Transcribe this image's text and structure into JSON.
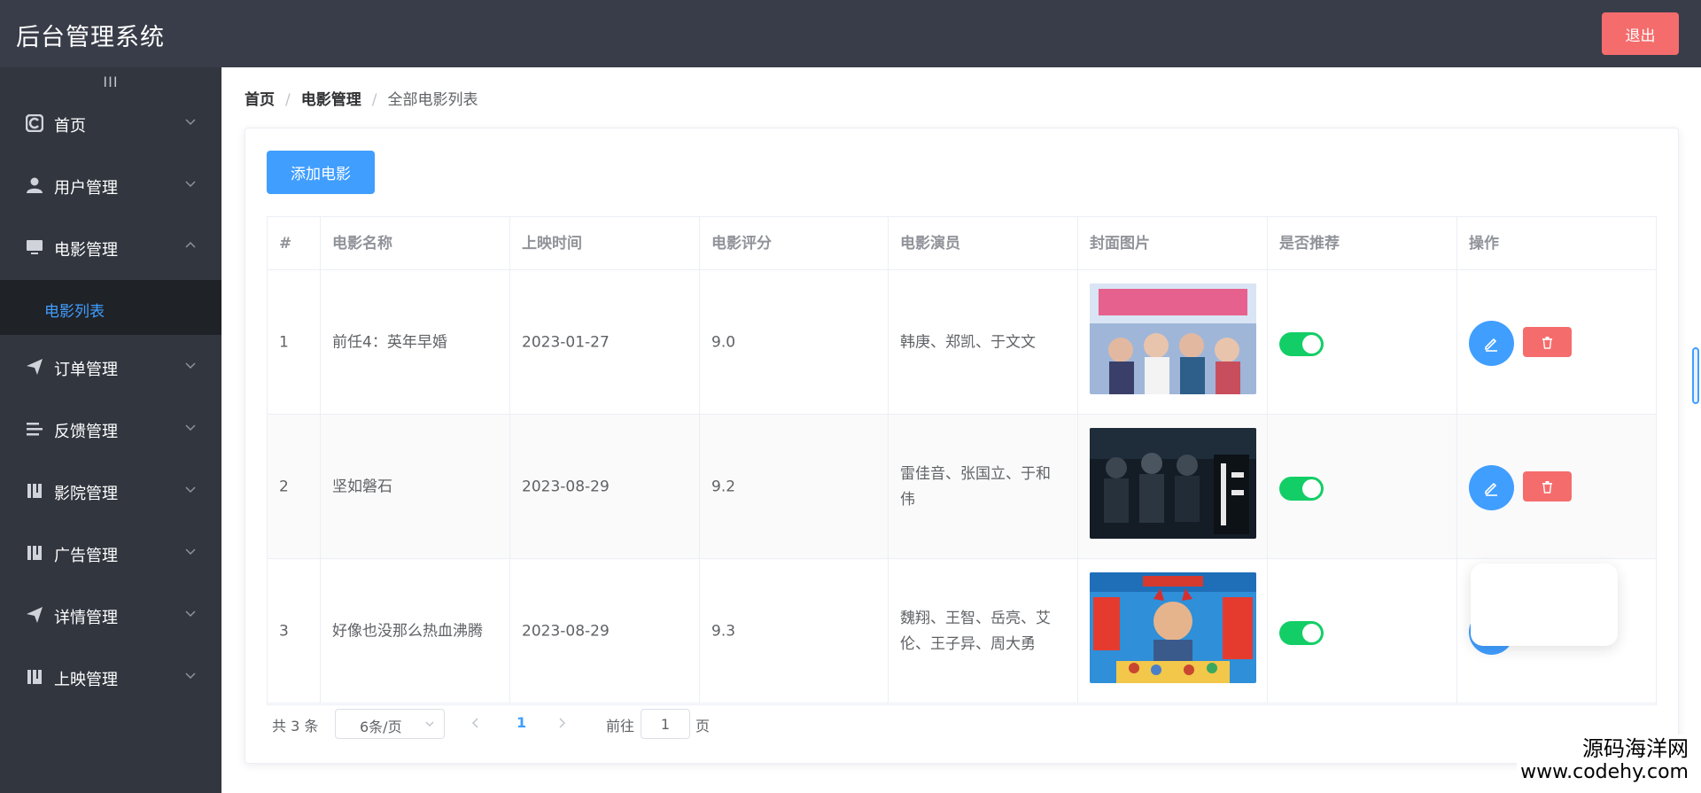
{
  "header": {
    "app_title": "后台管理系统",
    "logout_label": "退出"
  },
  "sidebar": {
    "toggle_glyph": "III",
    "items": [
      {
        "label": "首页",
        "icon": "dashboard-icon",
        "expanded": false
      },
      {
        "label": "用户管理",
        "icon": "user-icon",
        "expanded": false
      },
      {
        "label": "电影管理",
        "icon": "monitor-icon",
        "expanded": true
      },
      {
        "label": "订单管理",
        "icon": "paper-plane-icon",
        "expanded": false
      },
      {
        "label": "反馈管理",
        "icon": "list-icon",
        "expanded": false
      },
      {
        "label": "影院管理",
        "icon": "book-icon",
        "expanded": false
      },
      {
        "label": "广告管理",
        "icon": "book-icon",
        "expanded": false
      },
      {
        "label": "详情管理",
        "icon": "paper-plane-icon",
        "expanded": false
      },
      {
        "label": "上映管理",
        "icon": "book-icon",
        "expanded": false
      }
    ],
    "submenu_active": "电影列表"
  },
  "breadcrumb": {
    "home": "首页",
    "section": "电影管理",
    "current": "全部电影列表",
    "separator": "/"
  },
  "toolbar": {
    "add_label": "添加电影"
  },
  "table": {
    "columns": [
      "#",
      "电影名称",
      "上映时间",
      "电影评分",
      "电影演员",
      "封面图片",
      "是否推荐",
      "操作"
    ],
    "rows": [
      {
        "index": "1",
        "name": "前任4：英年早婚",
        "date": "2023-01-27",
        "score": "9.0",
        "actors": "韩庚、郑凯、于文文",
        "recommended": true
      },
      {
        "index": "2",
        "name": "坚如磐石",
        "date": "2023-08-29",
        "score": "9.2",
        "actors": "雷佳音、张国立、于和伟",
        "recommended": true
      },
      {
        "index": "3",
        "name": "好像也没那么热血沸腾",
        "date": "2023-08-29",
        "score": "9.3",
        "actors": "魏翔、王智、岳亮、艾伦、王子异、周大勇",
        "recommended": true
      }
    ]
  },
  "pagination": {
    "total": "共 3 条",
    "page_size": "6条/页",
    "current_page": "1",
    "goto_label": "前往",
    "goto_value": "1",
    "page_suffix": "页"
  },
  "watermark": {
    "line1": "源码海洋网",
    "line2": "www.codehy.com"
  },
  "colors": {
    "sidebar_bg": "#32363f",
    "header_bg": "#393d49",
    "primary": "#409eff",
    "danger": "#f56c6c",
    "success": "#13ce66"
  }
}
